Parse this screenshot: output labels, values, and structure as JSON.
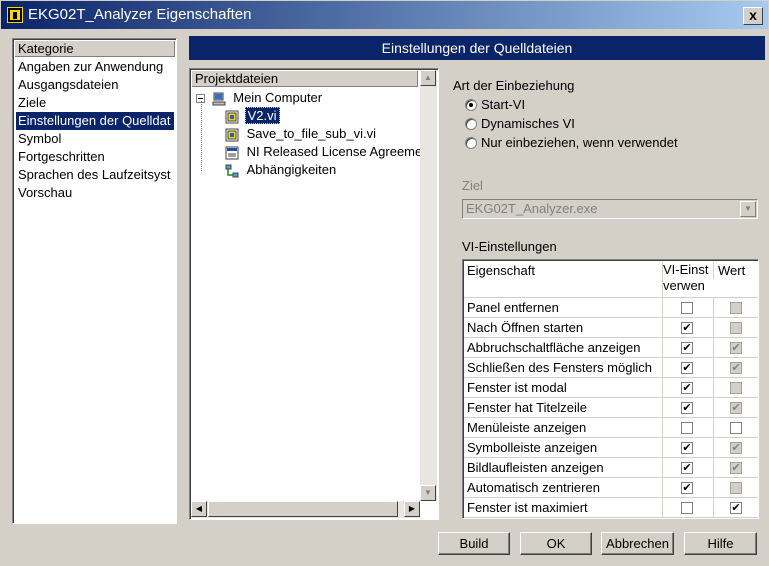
{
  "window": {
    "title": "EKG02T_Analyzer Eigenschaften",
    "close_label": "x"
  },
  "category": {
    "header": "Kategorie",
    "items": [
      "Angaben zur Anwendung",
      "Ausgangsdateien",
      "Ziele",
      "Einstellungen der Quelldat",
      "Symbol",
      "Fortgeschritten",
      "Sprachen des Laufzeitsyst",
      "Vorschau"
    ],
    "selected_index": 3
  },
  "panel_title": "Einstellungen der Quelldateien",
  "project": {
    "header": "Projektdateien",
    "root": "Mein Computer",
    "files": [
      "V2.vi",
      "Save_to_file_sub_vi.vi",
      "NI Released License Agreeme",
      "Abhängigkeiten"
    ],
    "selected_index": 0
  },
  "inclusion": {
    "label": "Art der Einbeziehung",
    "options": [
      "Start-VI",
      "Dynamisches VI",
      "Nur einbeziehen, wenn verwendet"
    ],
    "selected_index": 0
  },
  "target": {
    "label": "Ziel",
    "value": "EKG02T_Analyzer.exe"
  },
  "vi_settings": {
    "label": "VI-Einstellungen",
    "columns": [
      "Eigenschaft",
      "VI-Einst verwen",
      "Wert"
    ],
    "rows": [
      {
        "name": "Panel entfernen",
        "use": false,
        "value": false,
        "value_enabled": false
      },
      {
        "name": "Nach Öffnen starten",
        "use": true,
        "value": false,
        "value_enabled": false
      },
      {
        "name": "Abbruchschaltfläche anzeigen",
        "use": true,
        "value": true,
        "value_enabled": false
      },
      {
        "name": "Schließen des Fensters möglich",
        "use": true,
        "value": true,
        "value_enabled": false
      },
      {
        "name": "Fenster ist modal",
        "use": true,
        "value": false,
        "value_enabled": false
      },
      {
        "name": "Fenster hat Titelzeile",
        "use": true,
        "value": true,
        "value_enabled": false
      },
      {
        "name": "Menüleiste anzeigen",
        "use": false,
        "value": false,
        "value_enabled": true
      },
      {
        "name": "Symbolleiste anzeigen",
        "use": true,
        "value": true,
        "value_enabled": false
      },
      {
        "name": "Bildlaufleisten anzeigen",
        "use": true,
        "value": true,
        "value_enabled": false
      },
      {
        "name": "Automatisch zentrieren",
        "use": true,
        "value": false,
        "value_enabled": false
      },
      {
        "name": "Fenster ist maximiert",
        "use": false,
        "value": true,
        "value_enabled": true
      }
    ]
  },
  "buttons": {
    "build": "Build",
    "ok": "OK",
    "cancel": "Abbrechen",
    "help": "Hilfe"
  }
}
